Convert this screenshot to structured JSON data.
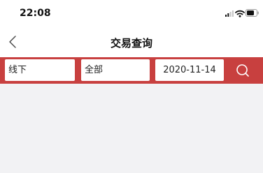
{
  "status_bar": {
    "time": "22:08",
    "icons": [
      "signal-icon",
      "wifi-icon",
      "battery-icon"
    ]
  },
  "nav": {
    "back_icon": "chevron-left-icon",
    "title": "交易查询"
  },
  "filters": {
    "channel": "线下",
    "type": "全部",
    "date": "2020-11-14",
    "search_icon": "search-icon"
  },
  "colors": {
    "accent": "#c8403f",
    "background": "#f2f2f4",
    "surface": "#ffffff"
  }
}
